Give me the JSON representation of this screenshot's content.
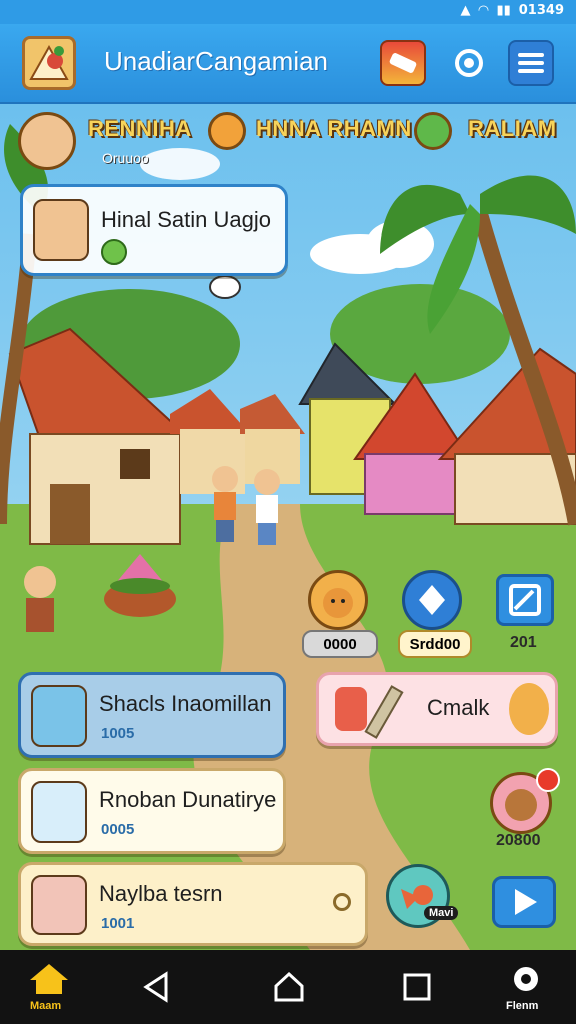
{
  "status": {
    "time": "01349",
    "signal_text": "ᴵᴵ ⁵⁸ᴵ"
  },
  "header": {
    "title": "UnadiarCangamian"
  },
  "resources": {
    "player_name": "RENNIHA",
    "player_sub": "Oruuoo",
    "middle": "HNNA RHAMN",
    "right": "RALIAM"
  },
  "quest": {
    "text": "Hinal Satin Uagjo"
  },
  "shortcuts": {
    "pet_count": "0000",
    "crystal_count": "Srdd00",
    "map_count": "201"
  },
  "cards": {
    "card1": {
      "title": "Shacls Inaomillan",
      "sub": "1005"
    },
    "card2": {
      "title": "Rnoban Dunatirye",
      "sub": "0005"
    },
    "card3": {
      "title": "Naylba tesrn",
      "sub": "1001"
    },
    "craft": {
      "title": "Cmalk"
    },
    "character_count": "20800",
    "fox_label": "Mavi"
  },
  "nav": {
    "home_label": "Maam",
    "settings_label": "Flenm"
  }
}
